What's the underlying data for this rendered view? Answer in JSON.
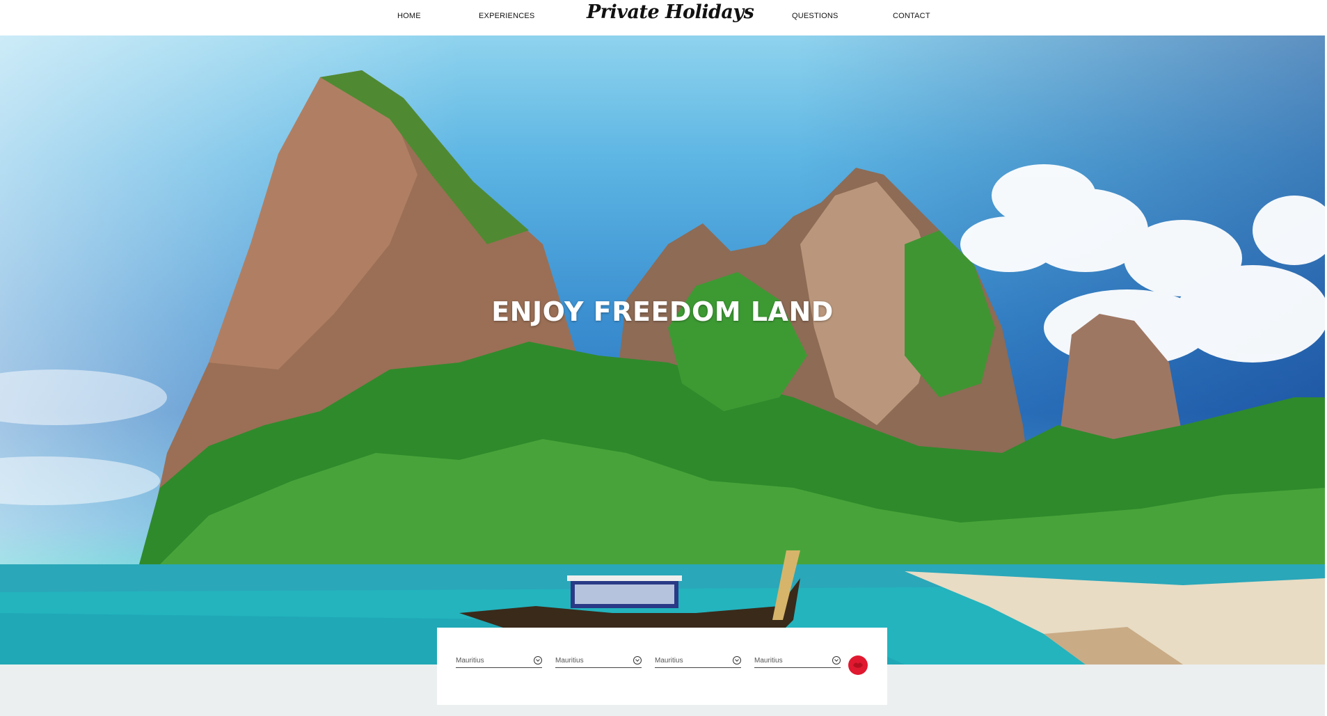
{
  "nav": {
    "home": "HOME",
    "experiences": "EXPERIENCES",
    "logo": "Private Holidays",
    "questions": "QUESTIONS",
    "contact": "CONTACT"
  },
  "hero": {
    "headline": "ENJOY FREEDOM LAND"
  },
  "search": {
    "fields": [
      {
        "value": "Mauritius"
      },
      {
        "value": "Mauritius"
      },
      {
        "value": "Mauritius"
      },
      {
        "value": "Mauritius"
      }
    ],
    "button_color": "#e01930"
  }
}
